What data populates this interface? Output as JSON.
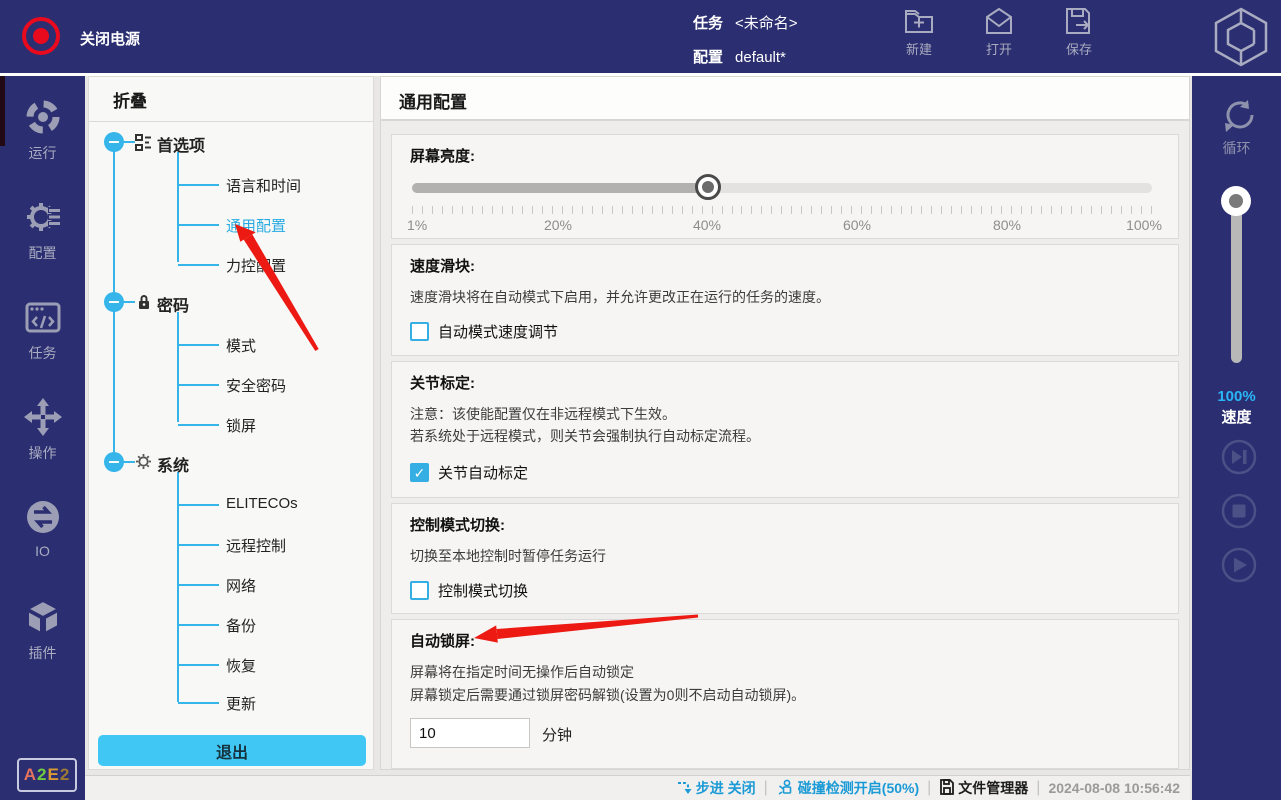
{
  "topbar": {
    "power_label": "关闭电源",
    "task_label": "任务",
    "task_value": "<未命名>",
    "config_label": "配置",
    "config_value": "default*",
    "actions": [
      {
        "label": "新建",
        "icon": "new-file-icon"
      },
      {
        "label": "打开",
        "icon": "open-file-icon"
      },
      {
        "label": "保存",
        "icon": "save-icon"
      }
    ],
    "logo_icon": "elite-logo-icon"
  },
  "left_sidebar": {
    "items": [
      {
        "label": "运行",
        "icon": "run-icon"
      },
      {
        "label": "配置",
        "icon": "config-icon"
      },
      {
        "label": "任务",
        "icon": "task-icon"
      },
      {
        "label": "操作",
        "icon": "operate-icon"
      },
      {
        "label": "IO",
        "icon": "io-icon"
      },
      {
        "label": "插件",
        "icon": "plugin-icon"
      }
    ],
    "badge": {
      "chars": [
        {
          "ch": "A",
          "color": "#e2735f"
        },
        {
          "ch": "2",
          "color": "#72cc3f"
        },
        {
          "ch": "E",
          "color": "#d89a33"
        },
        {
          "ch": "2",
          "color": "#9c7a35"
        }
      ]
    }
  },
  "tree_panel": {
    "title": "折叠",
    "groups": [
      {
        "label": "首选项",
        "icon": "preferences-icon",
        "children": [
          "语言和时间",
          "通用配置",
          "力控配置"
        ],
        "selected_child": "通用配置"
      },
      {
        "label": "密码",
        "icon": "lock-icon",
        "children": [
          "模式",
          "安全密码",
          "锁屏"
        ]
      },
      {
        "label": "系统",
        "icon": "gear-icon",
        "children": [
          "ELITECOs",
          "远程控制",
          "网络",
          "备份",
          "恢复",
          "更新"
        ]
      }
    ],
    "exit_button": "退出"
  },
  "main": {
    "title": "通用配置",
    "brightness": {
      "title": "屏幕亮度:",
      "value_percent": 40,
      "tick_labels": [
        "1%",
        "20%",
        "40%",
        "60%",
        "80%",
        "100%"
      ]
    },
    "speed_slider": {
      "title": "速度滑块:",
      "desc": "速度滑块将在自动模式下启用，并允许更改正在运行的任务的速度。",
      "checkbox_label": "自动模式速度调节",
      "checked": false
    },
    "joint_calibration": {
      "title": "关节标定:",
      "desc1": "注意：该使能配置仅在非远程模式下生效。",
      "desc2": "若系统处于远程模式，则关节会强制执行自动标定流程。",
      "checkbox_label": "关节自动标定",
      "checked": true
    },
    "control_mode": {
      "title": "控制模式切换:",
      "desc": "切换至本地控制时暂停任务运行",
      "checkbox_label": "控制模式切换",
      "checked": false
    },
    "auto_lock": {
      "title": "自动锁屏:",
      "desc1": "屏幕将在指定时间无操作后自动锁定",
      "desc2": "屏幕锁定后需要通过锁屏密码解锁(设置为0则不启动自动锁屏)。",
      "input_value": "10",
      "unit": "分钟"
    }
  },
  "right_sidebar": {
    "loop_label": "循环",
    "speed_percent": "100%",
    "speed_label": "速度",
    "buttons": [
      "skip-next-icon",
      "stop-icon",
      "play-icon"
    ]
  },
  "statusbar": {
    "step": "步进 关闭",
    "collision": "碰撞检测开启(50%)",
    "file_manager": "文件管理器",
    "datetime": "2024-08-08 10:56:42"
  },
  "colors": {
    "navy": "#2b2e70",
    "accent_blue": "#29abe2",
    "exit_button": "#41c7f4",
    "arrow_red": "#ec1a12",
    "status_blue": "#1a9ad6"
  }
}
